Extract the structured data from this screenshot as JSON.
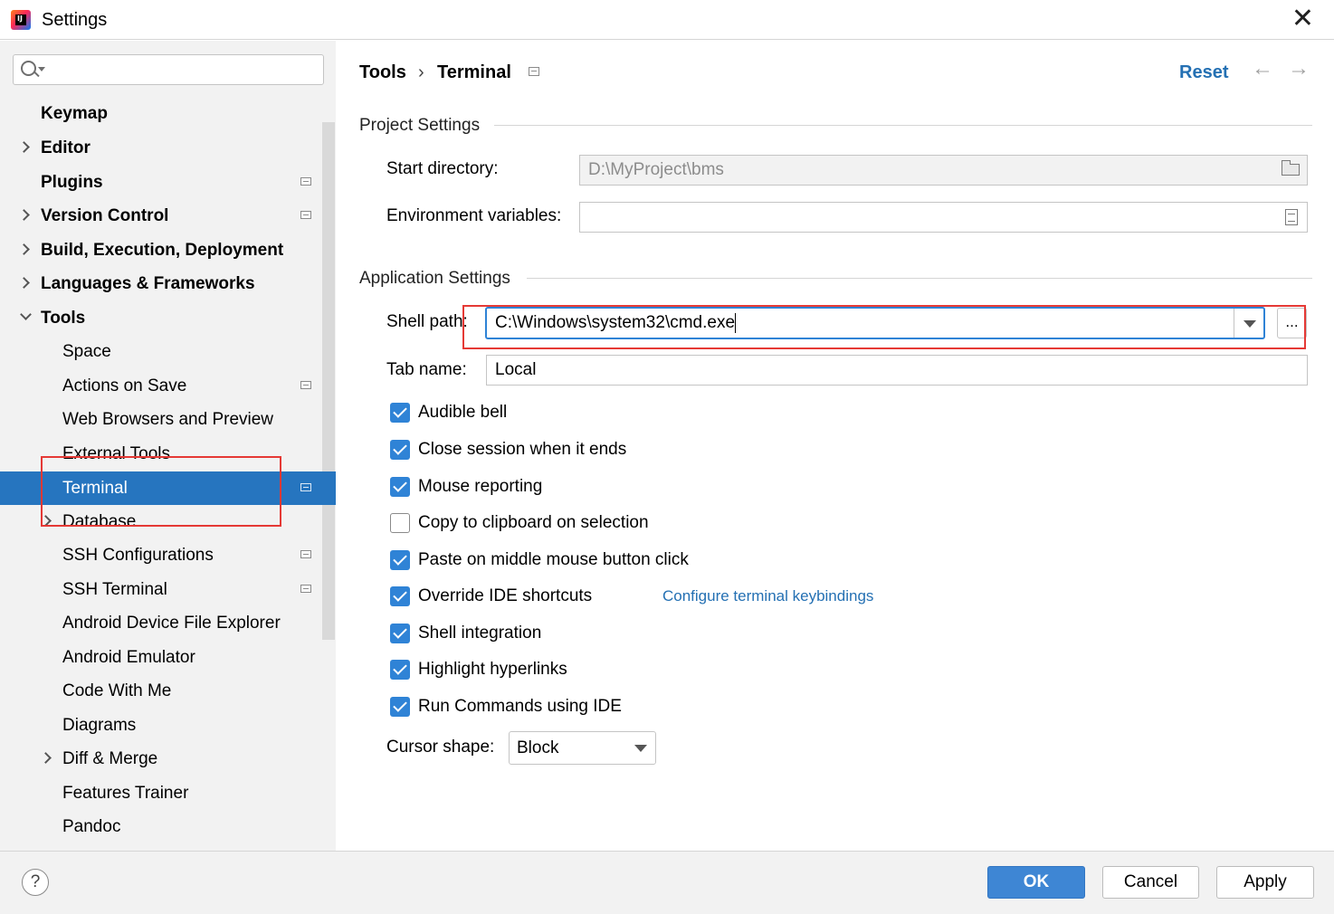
{
  "window": {
    "title": "Settings",
    "close_glyph": "✕"
  },
  "sidebar": {
    "search": {
      "value": "",
      "placeholder": ""
    },
    "items": [
      {
        "label": "Keymap"
      },
      {
        "label": "Editor"
      },
      {
        "label": "Plugins"
      },
      {
        "label": "Version Control"
      },
      {
        "label": "Build, Execution, Deployment"
      },
      {
        "label": "Languages & Frameworks"
      },
      {
        "label": "Tools"
      },
      {
        "label": "Space"
      },
      {
        "label": "Actions on Save"
      },
      {
        "label": "Web Browsers and Preview"
      },
      {
        "label": "External Tools"
      },
      {
        "label": "Terminal"
      },
      {
        "label": "Database"
      },
      {
        "label": "SSH Configurations"
      },
      {
        "label": "SSH Terminal"
      },
      {
        "label": "Android Device File Explorer"
      },
      {
        "label": "Android Emulator"
      },
      {
        "label": "Code With Me"
      },
      {
        "label": "Diagrams"
      },
      {
        "label": "Diff & Merge"
      },
      {
        "label": "Features Trainer"
      },
      {
        "label": "Pandoc"
      }
    ]
  },
  "header": {
    "breadcrumb": [
      "Tools",
      "Terminal"
    ],
    "separator": "›",
    "reset_label": "Reset",
    "back_glyph": "←",
    "forward_glyph": "→"
  },
  "project_settings": {
    "title": "Project Settings",
    "start_directory": {
      "label": "Start directory:",
      "value": "D:\\MyProject\\bms"
    },
    "environment_variables": {
      "label": "Environment variables:",
      "value": ""
    }
  },
  "application_settings": {
    "title": "Application Settings",
    "shell_path": {
      "label": "Shell path:",
      "value": "C:\\Windows\\system32\\cmd.exe",
      "browse_label": "..."
    },
    "tab_name": {
      "label": "Tab name:",
      "value": "Local"
    },
    "checkboxes": [
      {
        "label": "Audible bell",
        "checked": true
      },
      {
        "label": "Close session when it ends",
        "checked": true
      },
      {
        "label": "Mouse reporting",
        "checked": true
      },
      {
        "label": "Copy to clipboard on selection",
        "checked": false
      },
      {
        "label": "Paste on middle mouse button click",
        "checked": true
      },
      {
        "label": "Override IDE shortcuts",
        "checked": true,
        "link": "Configure terminal keybindings"
      },
      {
        "label": "Shell integration",
        "checked": true
      },
      {
        "label": "Highlight hyperlinks",
        "checked": true
      },
      {
        "label": "Run Commands using IDE",
        "checked": true
      }
    ],
    "cursor_shape": {
      "label": "Cursor shape:",
      "value": "Block"
    }
  },
  "footer": {
    "help_glyph": "?",
    "ok_label": "OK",
    "cancel_label": "Cancel",
    "apply_label": "Apply"
  },
  "colors": {
    "accent": "#2f83d6",
    "selection": "#2675bf",
    "link": "#2470b3",
    "highlight_box": "#e53935"
  }
}
